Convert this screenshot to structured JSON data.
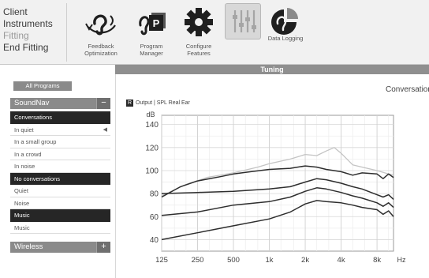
{
  "steps": [
    {
      "label": "Client",
      "active": true
    },
    {
      "label": "Instruments",
      "active": true
    },
    {
      "label": "Fitting",
      "active": false
    },
    {
      "label": "End Fitting",
      "active": true
    }
  ],
  "tools": [
    {
      "label_lines": [
        "Feedback",
        "Optimization"
      ],
      "icon": "feedback-optimization-icon"
    },
    {
      "label_lines": [
        "Program",
        "Manager"
      ],
      "icon": "program-manager-icon"
    },
    {
      "label_lines": [
        "Configure",
        "Features"
      ],
      "icon": "configure-features-icon"
    },
    {
      "label_lines": [
        "",
        ""
      ],
      "icon": "tuning-sliders-icon"
    },
    {
      "label_lines": [
        "Data Logging",
        ""
      ],
      "icon": "data-logging-icon"
    }
  ],
  "tuning_bar": "Tuning",
  "left_panel": {
    "all_programs": "All Programs",
    "soundnav": {
      "title": "SoundNav",
      "button": "−"
    },
    "items": [
      {
        "label": "Conversations",
        "selected": true
      },
      {
        "label": "In quiet",
        "selected": false,
        "arrow": "◀"
      },
      {
        "label": "In a small group",
        "selected": false
      },
      {
        "label": "In a crowd",
        "selected": false
      },
      {
        "label": "In noise",
        "selected": false
      },
      {
        "label": "No conversations",
        "selected": true
      },
      {
        "label": "Quiet",
        "selected": false
      },
      {
        "label": "Noise",
        "selected": false
      },
      {
        "label": "Music",
        "selected": true
      },
      {
        "label": "Music",
        "selected": false
      }
    ],
    "wireless": {
      "title": "Wireless",
      "button": "+"
    }
  },
  "main_title": "Conversations",
  "chart_legend": {
    "badge": "R",
    "text": "Output | SPL Real Ear"
  },
  "chart_data": {
    "type": "line",
    "xscale": "log",
    "ylabel": "dB",
    "xunit": "Hz",
    "x_ticks": [
      {
        "value": 125,
        "label": "125"
      },
      {
        "value": 250,
        "label": "250"
      },
      {
        "value": 500,
        "label": "500"
      },
      {
        "value": 1000,
        "label": "1k"
      },
      {
        "value": 2000,
        "label": "2k"
      },
      {
        "value": 4000,
        "label": "4k"
      },
      {
        "value": 8000,
        "label": "8k"
      }
    ],
    "xlim": [
      125,
      11000
    ],
    "ylim": [
      30,
      148
    ],
    "y_ticks": [
      40,
      60,
      80,
      100,
      120,
      140
    ],
    "grid": true,
    "series": [
      {
        "color": "#c4c4c4",
        "width": 1.3,
        "x": [
          125,
          200,
          300,
          500,
          800,
          1000,
          1500,
          2000,
          2500,
          3000,
          3500,
          4000,
          5000,
          6000,
          8000,
          10000,
          11000
        ],
        "y": [
          78,
          88,
          94,
          98,
          103,
          106,
          110,
          114,
          113,
          117,
          120,
          115,
          105,
          103,
          100,
          97,
          96
        ]
      },
      {
        "color": "#2e2e2e",
        "width": 1.5,
        "x": [
          125,
          180,
          250,
          400,
          500,
          700,
          1000,
          1500,
          2000,
          2500,
          3000,
          4000,
          5000,
          6000,
          8000,
          9000,
          10000,
          11000
        ],
        "y": [
          77,
          86,
          91,
          95,
          97,
          99,
          101,
          102,
          104,
          103,
          101,
          99,
          96,
          98,
          97,
          93,
          97,
          94
        ]
      },
      {
        "color": "#2e2e2e",
        "width": 1.5,
        "x": [
          125,
          250,
          500,
          1000,
          1500,
          2000,
          2500,
          3000,
          4000,
          5000,
          6000,
          8000,
          9000,
          10000,
          11000
        ],
        "y": [
          80,
          81,
          82,
          84,
          86,
          90,
          93,
          92,
          89,
          86,
          84,
          79,
          77,
          79,
          75
        ]
      },
      {
        "color": "#2e2e2e",
        "width": 1.5,
        "x": [
          125,
          250,
          500,
          1000,
          1500,
          2000,
          2500,
          3000,
          4000,
          5000,
          6000,
          8000,
          9000,
          10000,
          11000
        ],
        "y": [
          61,
          64,
          70,
          73,
          77,
          82,
          85,
          84,
          81,
          78,
          76,
          72,
          69,
          72,
          68
        ]
      },
      {
        "color": "#2e2e2e",
        "width": 1.5,
        "x": [
          125,
          250,
          500,
          1000,
          1500,
          2000,
          2500,
          3000,
          4000,
          5000,
          6000,
          8000,
          9000,
          10000,
          11000
        ],
        "y": [
          40,
          46,
          52,
          58,
          64,
          71,
          74,
          73,
          72,
          70,
          68,
          66,
          62,
          65,
          60
        ]
      }
    ]
  }
}
